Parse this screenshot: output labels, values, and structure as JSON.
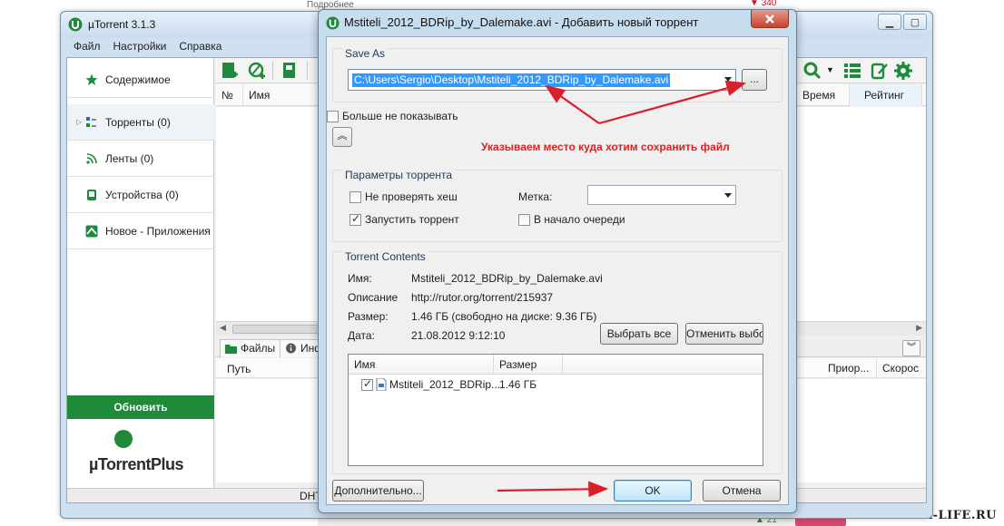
{
  "background": {
    "top_link": "Подробнее",
    "top_rating": "340",
    "bottom_green": "21",
    "watermark": "USER-LIFE.RU"
  },
  "main_window": {
    "title": "µTorrent 3.1.3",
    "menu": [
      "Файл",
      "Настройки",
      "Справка"
    ],
    "sidebar": {
      "items": [
        {
          "label": "Содержимое",
          "icon": "star-icon"
        },
        {
          "label": "Торренты (0)",
          "icon": "torrents-icon"
        },
        {
          "label": "Ленты (0)",
          "icon": "rss-icon"
        },
        {
          "label": "Устройства (0)",
          "icon": "device-icon"
        },
        {
          "label": "Новое - Приложения",
          "icon": "apps-icon"
        }
      ],
      "update_button": "Обновить",
      "plus_logo_text": "µTorrentPlus"
    },
    "list_columns": {
      "num": "№",
      "name": "Имя",
      "time": "Время",
      "rating": "Рейтинг"
    },
    "details": {
      "tab_files": "Файлы",
      "tab_info": "Инф",
      "col_path": "Путь",
      "col_priority": "Приор...",
      "col_speed": "Скорос"
    },
    "status_dht": "DHT"
  },
  "dialog": {
    "title": "Mstiteli_2012_BDRip_by_Dalemake.avi - Добавить новый торрент",
    "save_as": {
      "group_title": "Save As",
      "path": "C:\\Users\\Sergio\\Desktop\\Mstiteli_2012_BDRip_by_Dalemake.avi",
      "browse_label": "..."
    },
    "dont_show_label": "Больше не показывать",
    "dont_show_checked": false,
    "annotation": "Указываем место куда хотим сохранить файл",
    "params": {
      "group_title": "Параметры торрента",
      "skip_hash_label": "Не проверять хеш",
      "skip_hash_checked": false,
      "start_label": "Запустить торрент",
      "start_checked": true,
      "label_caption": "Метка:",
      "label_value": "",
      "queue_top_label": "В начало очереди",
      "queue_top_checked": false
    },
    "contents": {
      "group_title": "Torrent Contents",
      "name_label": "Имя:",
      "name_value": "Mstiteli_2012_BDRip_by_Dalemake.avi",
      "comment_label": "Описание",
      "comment_value": "http://rutor.org/torrent/215937",
      "size_label": "Размер:",
      "size_value": "1.46 ГБ (свободно на диске: 9.36 ГБ)",
      "date_label": "Дата:",
      "date_value": "21.08.2012 9:12:10",
      "select_all": "Выбрать все",
      "deselect": "Отменить выбор",
      "table_columns": {
        "name": "Имя",
        "size": "Размер"
      },
      "files": [
        {
          "name": "Mstiteli_2012_BDRip...",
          "size": "1.46 ГБ",
          "checked": true
        }
      ]
    },
    "advanced_button": "Дополнительно...",
    "ok_button": "OK",
    "cancel_button": "Отмена"
  },
  "colors": {
    "accent_green": "#1e8a3a",
    "annotation_red": "#e01f1f",
    "selection_blue": "#3399ff"
  }
}
